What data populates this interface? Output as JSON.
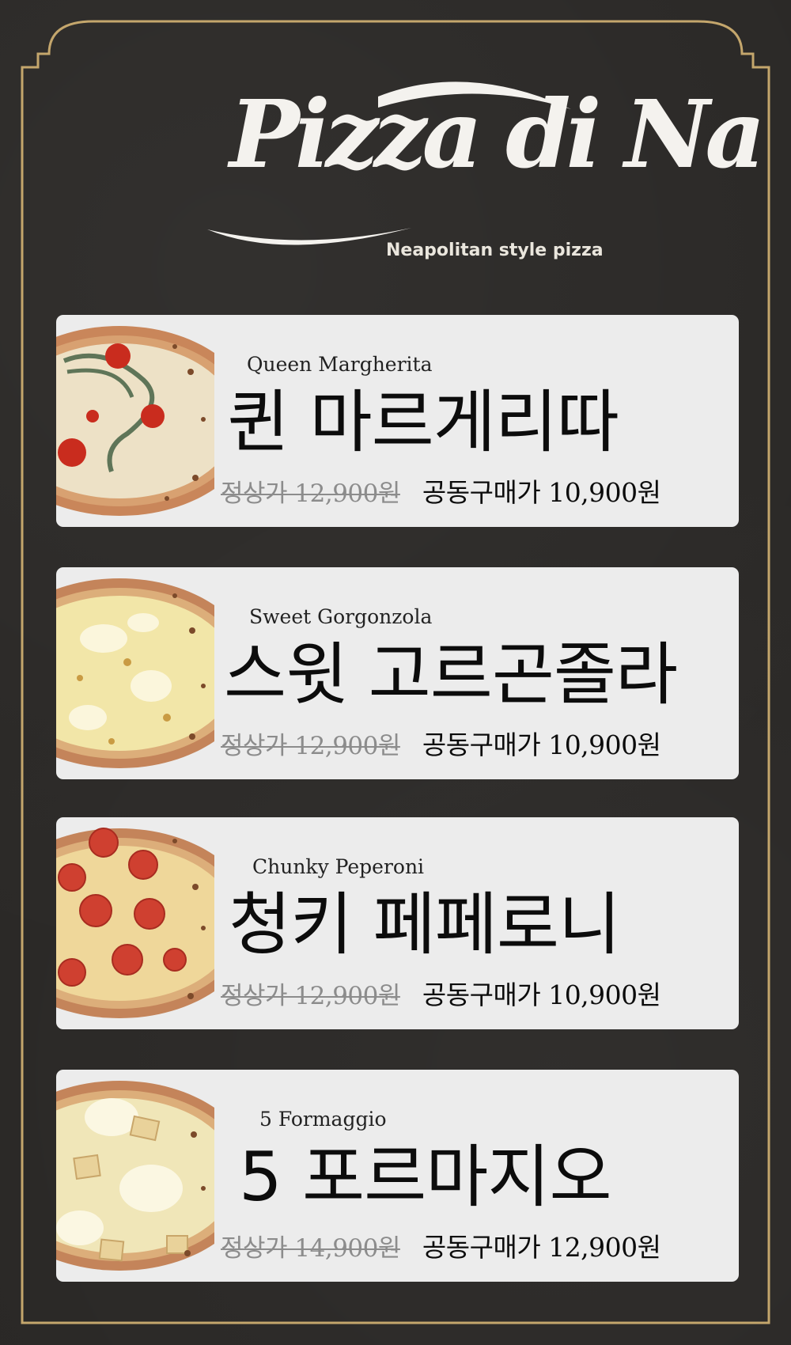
{
  "brand": {
    "logo_text": "Pizza di Na",
    "tagline": "Neapolitan style pizza"
  },
  "colors": {
    "background": "#2a2826",
    "frame": "#c4a66c",
    "card": "#ececec",
    "struck_price": "#8c8c8c"
  },
  "menu": [
    {
      "name_en": "Queen Margherita",
      "name_ko": "퀸 마르게리따",
      "regular_price": "정상가 12,900원",
      "group_price": "공동구매가 10,900원",
      "image": "margherita-pizza"
    },
    {
      "name_en": "Sweet Gorgonzola",
      "name_ko": "스윗 고르곤졸라",
      "regular_price": "정상가 12,900원",
      "group_price": "공동구매가 10,900원",
      "image": "gorgonzola-pizza"
    },
    {
      "name_en": "Chunky Peperoni",
      "name_ko": "청키 페페로니",
      "regular_price": "정상가 12,900원",
      "group_price": "공동구매가 10,900원",
      "image": "pepperoni-pizza"
    },
    {
      "name_en": "5 Formaggio",
      "name_ko": "5 포르마지오",
      "regular_price": "정상가 14,900원",
      "group_price": "공동구매가 12,900원",
      "image": "five-cheese-pizza"
    }
  ]
}
